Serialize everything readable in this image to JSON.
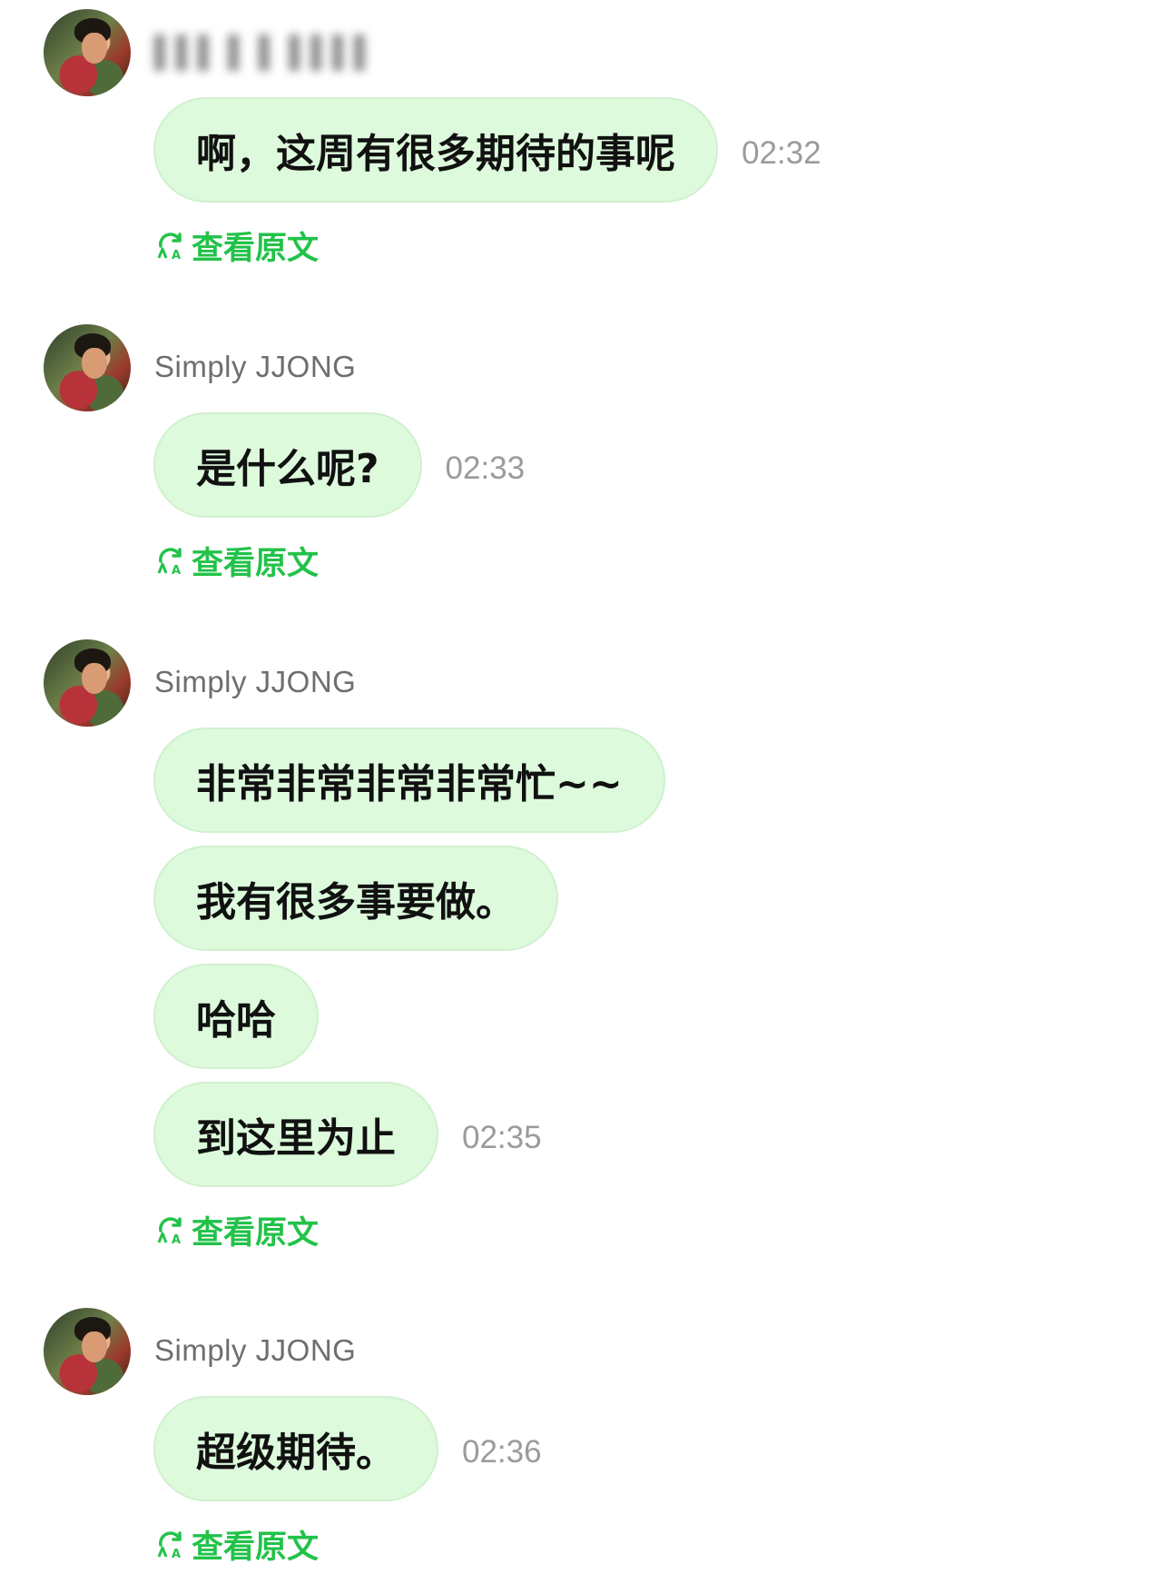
{
  "colors": {
    "bubble_bg": "#ddfbdc",
    "bubble_border": "#d0f0ce",
    "accent_green": "#22c249",
    "timestamp_gray": "#9b9b9b",
    "sender_gray": "#6e6e6e"
  },
  "groups": [
    {
      "sender": "",
      "messages": [
        {
          "text": "啊，这周有很多期待的事呢",
          "time": "02:32"
        }
      ],
      "translate_link": "查看原文",
      "translate_icon": "refresh-translate-icon"
    },
    {
      "sender": "Simply JJONG",
      "messages": [
        {
          "text": "是什么呢?",
          "time": "02:33"
        }
      ],
      "translate_link": "查看原文",
      "translate_icon": "refresh-translate-icon"
    },
    {
      "sender": "Simply JJONG",
      "messages": [
        {
          "text": "非常非常非常非常忙~~",
          "time": ""
        },
        {
          "text": "我有很多事要做。",
          "time": ""
        },
        {
          "text": "哈哈",
          "time": ""
        },
        {
          "text": "到这里为止",
          "time": "02:35"
        }
      ],
      "translate_link": "查看原文",
      "translate_icon": "refresh-translate-icon"
    },
    {
      "sender": "Simply JJONG",
      "messages": [
        {
          "text": "超级期待。",
          "time": "02:36"
        }
      ],
      "translate_link": "查看原文",
      "translate_icon": "refresh-translate-icon"
    }
  ]
}
